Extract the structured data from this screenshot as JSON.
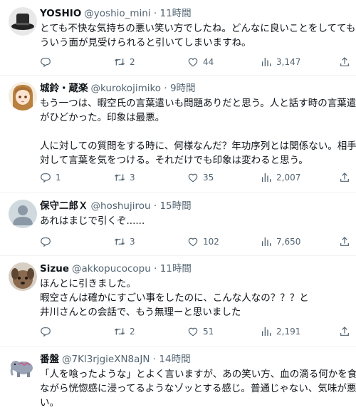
{
  "tweets": [
    {
      "name": "YOSHIO",
      "handle": "@yoshio_mini",
      "sep": "·",
      "time": "11時間",
      "lines": [
        "とても不快な気持ちの悪い笑い方でしたね。どんなに良いことをしてても",
        "ういう面が見受けられると引いてしまいますね。"
      ],
      "replies": "",
      "retweets": "2",
      "likes": "44",
      "views": "3,147",
      "avatar": "black-hat"
    },
    {
      "name": "城鈴・蔵楽",
      "handle": "@kurokojimiko",
      "sep": "·",
      "time": "9時間",
      "lines": [
        "もう一つは、暇空氏の言葉遣いも問題ありだと思う。人と話す時の言葉遣い",
        "がひどかった。印象は最悪。",
        "",
        "人に対しての質問をする時に、何様なんだ？年功序列とは関係ない。相手に",
        "対して言葉を気をつける。それだけでも印象は変わると思う。"
      ],
      "replies": "1",
      "retweets": "3",
      "likes": "35",
      "views": "2,007",
      "avatar": "anime-girl"
    },
    {
      "name": "保守二郎Ｘ",
      "handle": "@hoshujirou",
      "sep": "·",
      "time": "15時間",
      "lines": [
        "あれはまじで引くぞ......"
      ],
      "replies": "",
      "retweets": "3",
      "likes": "102",
      "views": "7,650",
      "avatar": "default"
    },
    {
      "name": "Sizue",
      "handle": "@akkopucocopu",
      "sep": "·",
      "time": "11時間",
      "lines": [
        "ほんとに引きました。",
        "暇空さんは確かにすごい事をしたのに、こんな人なの？？？と",
        "井川さんとの会話で、もう無理ーと思いました"
      ],
      "replies": "",
      "retweets": "2",
      "likes": "51",
      "views": "2,191",
      "avatar": "dog"
    },
    {
      "name": "番盤",
      "handle": "@7Kl3rjgieXN8aJN",
      "sep": "·",
      "time": "14時間",
      "lines": [
        "「人を喰ったような」とよく言いますが、あの笑い方、血の滴る何かを食べ",
        "ながら恍惚感に浸ってるようなゾッとする感じ。普通じゃない、気味が悪",
        "い。"
      ],
      "replies": "",
      "retweets": "",
      "likes": "",
      "views": "",
      "avatar": "elephant"
    }
  ],
  "icons": {
    "reply": "reply-icon",
    "retweet": "retweet-icon",
    "like": "heart-icon",
    "views": "views-icon",
    "share": "share-icon"
  },
  "colors": {
    "text": "#0f1419",
    "secondary": "#536471",
    "divider": "#eff3f4"
  }
}
